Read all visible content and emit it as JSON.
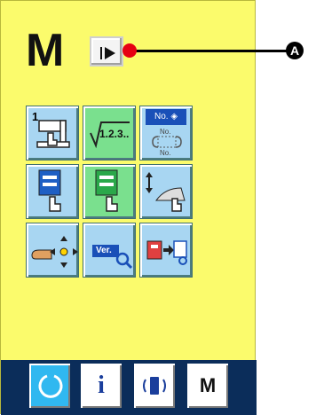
{
  "screen": {
    "mode_letter": "M",
    "callout_marker": "A"
  },
  "tiles": [
    {
      "name": "sewing-data-1-button",
      "label": "1",
      "icon": "sewing-machine-hand-icon",
      "color": "blue"
    },
    {
      "name": "sequence-number-button",
      "label": "1.2.3..",
      "icon": "check-number-icon",
      "color": "green"
    },
    {
      "name": "pattern-number-button",
      "label": "No.",
      "sublabels": [
        "No.",
        "No."
      ],
      "icon": "pattern-number-icon",
      "color": "blue"
    },
    {
      "name": "pattern-edit-button-1",
      "label": "",
      "icon": "pattern-hand-icon",
      "color": "blue"
    },
    {
      "name": "pattern-edit-button-2",
      "label": "",
      "icon": "pattern-hand-green-icon",
      "color": "green"
    },
    {
      "name": "presser-adjust-button",
      "label": "",
      "icon": "presser-hand-icon",
      "color": "blue"
    },
    {
      "name": "bobbin-move-button",
      "label": "",
      "icon": "bobbin-arrows-icon",
      "color": "blue"
    },
    {
      "name": "version-info-button",
      "label": "Ver.",
      "icon": "version-search-icon",
      "color": "blue"
    },
    {
      "name": "data-copy-button",
      "label": "",
      "icon": "data-copy-icon",
      "color": "blue"
    }
  ],
  "footer": {
    "buttons": [
      {
        "name": "reset-button",
        "icon": "reset-icon",
        "color": "#30b8f0"
      },
      {
        "name": "info-button",
        "label": "i",
        "icon": "info-icon",
        "color": "#ffffff"
      },
      {
        "name": "communication-button",
        "icon": "communication-icon",
        "color": "#ffffff"
      },
      {
        "name": "mode-button",
        "label": "M",
        "icon": "mode-icon",
        "color": "#ffffff"
      }
    ]
  },
  "colors": {
    "screen_background": "#fbfb6c",
    "footer_background": "#0b2d5a",
    "tile_blue": "#a8d6f2",
    "tile_green": "#7ae08e",
    "accent_red": "#e60012"
  }
}
